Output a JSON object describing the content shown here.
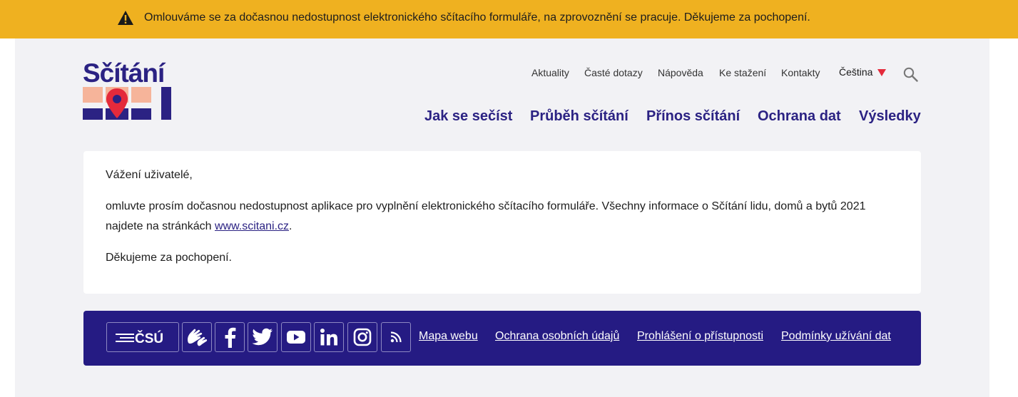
{
  "alert": {
    "icon": "warning-icon",
    "text": "Omlouváme se za dočasnou nedostupnost elektronického sčítacího formuláře, na zprovoznění se pracuje. Děkujeme za pochopení."
  },
  "logo": {
    "word": "Sčítání",
    "year": "2021"
  },
  "top_nav": {
    "items": [
      "Aktuality",
      "Časté dotazy",
      "Nápověda",
      "Ke stažení",
      "Kontakty"
    ],
    "language": "Čeština",
    "search_icon": "search-icon"
  },
  "main_nav": {
    "items": [
      "Jak se sečíst",
      "Průběh sčítání",
      "Přínos sčítání",
      "Ochrana dat",
      "Výsledky"
    ]
  },
  "content": {
    "greeting": "Vážení uživatelé,",
    "body_line1": "omluvte prosím dočasnou nedostupnost aplikace pro vyplnění elektronického sčítacího formuláře. Všechny informace o Sčítání lidu, domů a bytů 2021",
    "body_line2_prefix": "najdete na stránkách ",
    "link_text": "www.scitani.cz",
    "body_line2_suffix": ".",
    "thanks": "Děkujeme za pochopení."
  },
  "footer": {
    "csu_logo_text": "ČSÚ",
    "icons": [
      "sign-language-icon",
      "facebook-icon",
      "twitter-icon",
      "youtube-icon",
      "linkedin-icon",
      "instagram-icon",
      "rss-icon"
    ],
    "links": [
      "Mapa webu",
      "Ochrana osobních údajů",
      "Prohlášení o přístupnosti",
      "Podmínky užívání dat"
    ]
  },
  "colors": {
    "alert_bg": "#efb120",
    "brand_navy": "#2b2283",
    "footer_bg": "#251b83",
    "accent_red": "#e42a3b",
    "accent_peach": "#f6b49a"
  }
}
